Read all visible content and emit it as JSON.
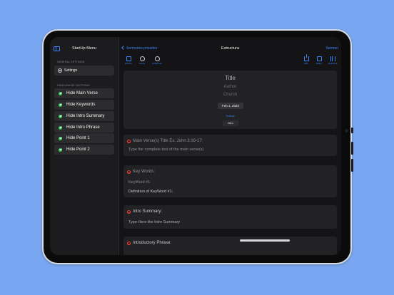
{
  "sidebar": {
    "title": "StartUp Menu",
    "general_header": "GENERAL SETTINGS",
    "settings_label": "Settings",
    "sections_header": "HIDE/UNHIDE SECTIONS",
    "items": [
      {
        "label": "Hide Main Verse"
      },
      {
        "label": "Hide Keywords"
      },
      {
        "label": "Hide Intro Summary"
      },
      {
        "label": "Hide Intro Phrase"
      },
      {
        "label": "Hide Point 1"
      },
      {
        "label": "Hide Point 2"
      }
    ]
  },
  "nav": {
    "back_label": "Sermones privados",
    "title": "Estructura",
    "right_label": "Sermon"
  },
  "toolbar": {
    "left": [
      {
        "label": "Edición",
        "icon": "doc-icon"
      },
      {
        "label": "Points",
        "icon": "circle-2-icon"
      },
      {
        "label": "SubPoints",
        "icon": "circle-3-icon"
      }
    ],
    "right": [
      {
        "label": "PDF",
        "icon": "share-icon"
      },
      {
        "label": "Editor",
        "icon": "doc-icon"
      },
      {
        "label": "Slidedeck",
        "icon": "columns-icon"
      }
    ]
  },
  "header_card": {
    "title": "Title",
    "author": "Author",
    "church": "Church",
    "date": "Feb 1, 2022",
    "link": "Textual",
    "type": "Otro"
  },
  "sections": [
    {
      "header": "Main Verse(s) Title Ex: John 3:16-17:",
      "lines": [
        "Type the complete text of the main verse(s)"
      ]
    },
    {
      "header": "Key Words:",
      "lines": [
        "KeyWord #1:",
        "Definition of KeyWord #1:"
      ]
    },
    {
      "header": "Intro Summary:",
      "lines": [
        "Type Here the Intro Summary"
      ]
    },
    {
      "header": "Introductory Phrase:",
      "lines": []
    }
  ],
  "colors": {
    "background": "#79a6f0",
    "accent": "#3b82f6",
    "check": "#34c759",
    "remove": "#ff3b30"
  }
}
